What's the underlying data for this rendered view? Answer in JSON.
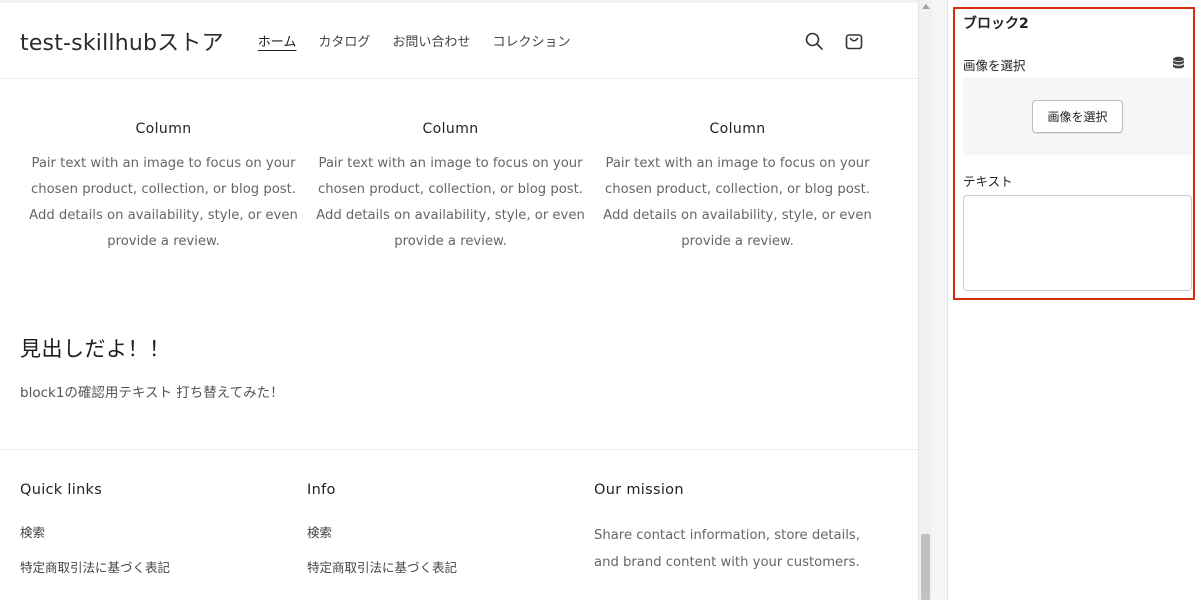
{
  "header": {
    "logo": "test-skillhubストア",
    "nav": [
      {
        "label": "ホーム",
        "active": true
      },
      {
        "label": "カタログ",
        "active": false
      },
      {
        "label": "お問い合わせ",
        "active": false
      },
      {
        "label": "コレクション",
        "active": false
      }
    ],
    "icons": [
      "search-icon",
      "cart-icon"
    ]
  },
  "columns": [
    {
      "title": "Column",
      "text": "Pair text with an image to focus on your chosen product, collection, or blog post. Add details on availability, style, or even provide a review."
    },
    {
      "title": "Column",
      "text": "Pair text with an image to focus on your chosen product, collection, or blog post. Add details on availability, style, or even provide a review."
    },
    {
      "title": "Column",
      "text": "Pair text with an image to focus on your chosen product, collection, or blog post. Add details on availability, style, or even provide a review."
    }
  ],
  "rich_text": {
    "heading": "見出しだよ！！",
    "body": "block1の確認用テキスト 打ち替えてみた！"
  },
  "footer": {
    "quick_links": {
      "heading": "Quick links",
      "links": [
        "検索",
        "特定商取引法に基づく表記"
      ]
    },
    "info": {
      "heading": "Info",
      "links": [
        "検索",
        "特定商取引法に基づく表記"
      ]
    },
    "mission": {
      "heading": "Our mission",
      "text": "Share contact information, store details, and brand content with your customers."
    }
  },
  "sidebar": {
    "block_title": "ブロック2",
    "image_label": "画像を選択",
    "image_button": "画像を選択",
    "text_label": "テキスト",
    "text_value": "",
    "database_icon": "database-icon",
    "highlight_color": "#d72c0d"
  }
}
